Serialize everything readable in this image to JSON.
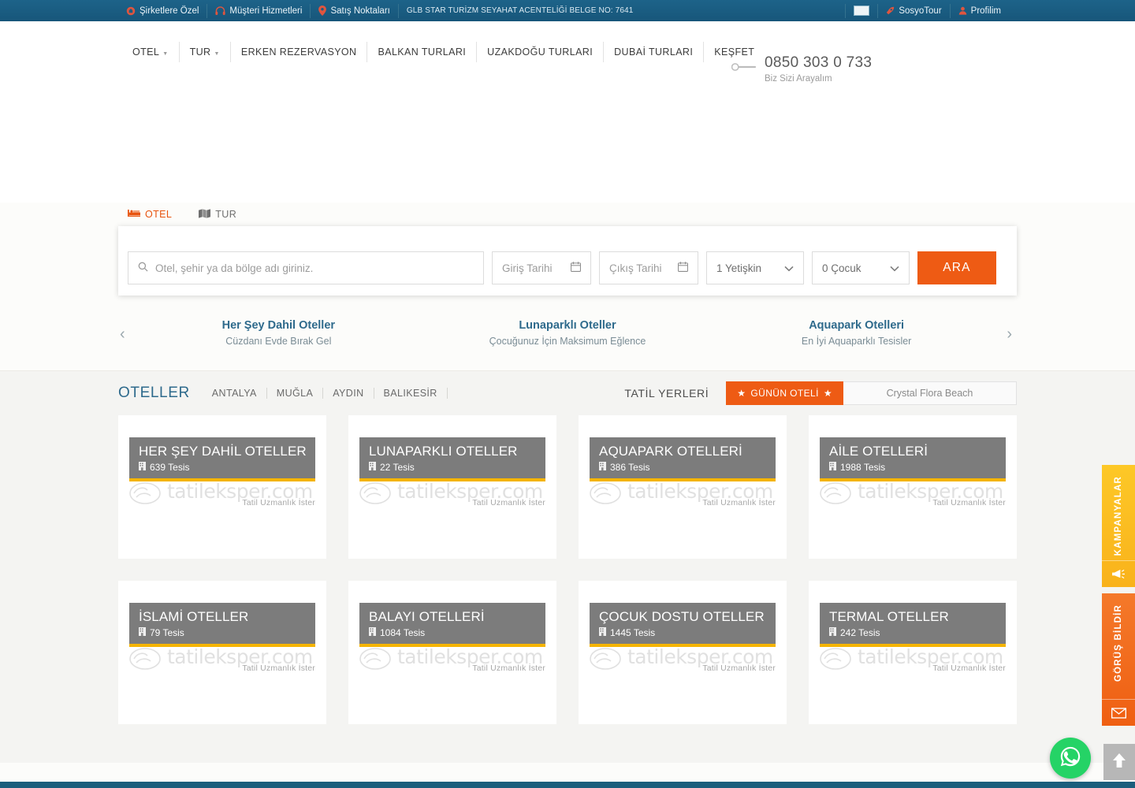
{
  "topbar": {
    "left_items": [
      {
        "icon": "briefcase-icon",
        "label": "Şirketlere Özel"
      },
      {
        "icon": "headset-icon",
        "label": "Müşteri Hizmetleri"
      },
      {
        "icon": "map-pin-icon",
        "label": "Satış Noktaları"
      }
    ],
    "license_text": "GLB STAR TURİZM SEYAHAT ACENTELİĞİ BELGE NO: 7641",
    "right_items": [
      {
        "icon": "flag-icon",
        "label": ""
      },
      {
        "icon": "rocket-icon",
        "label": "SosyoTour"
      },
      {
        "icon": "user-icon",
        "label": "Profilim"
      }
    ]
  },
  "nav": {
    "items": [
      {
        "label": "OTEL",
        "has_caret": true
      },
      {
        "label": "TUR",
        "has_caret": true
      },
      {
        "label": "ERKEN REZERVASYON",
        "has_caret": false
      },
      {
        "label": "BALKAN TURLARI",
        "has_caret": false
      },
      {
        "label": "UZAKDOĞU TURLARI",
        "has_caret": false
      },
      {
        "label": "DUBAİ TURLARI",
        "has_caret": false
      },
      {
        "label": "KEŞFET",
        "has_caret": false
      }
    ]
  },
  "phone": {
    "number": "0850 303 0 733",
    "subtitle": "Biz Sizi Arayalım"
  },
  "search": {
    "tabs": [
      {
        "label": "OTEL",
        "icon": "bed-icon",
        "active": true
      },
      {
        "label": "TUR",
        "icon": "map-book-icon",
        "active": false
      }
    ],
    "destination_placeholder": "Otel, şehir ya da bölge adı giriniz.",
    "checkin_placeholder": "Giriş Tarihi",
    "checkout_placeholder": "Çıkış Tarihi",
    "adults_value": "1 Yetişkin",
    "children_value": "0 Çocuk",
    "search_button": "ARA"
  },
  "promo": {
    "prev": "‹",
    "next": "›",
    "items": [
      {
        "title": "Her Şey Dahil Oteller",
        "subtitle": "Cüzdanı Evde Bırak Gel"
      },
      {
        "title": "Lunaparklı Oteller",
        "subtitle": "Çocuğunuz İçin Maksimum Eğlence"
      },
      {
        "title": "Aquapark Otelleri",
        "subtitle": "En İyi Aquaparklı Tesisler"
      }
    ]
  },
  "hotels": {
    "section_title": "OTELLER",
    "cities": [
      "ANTALYA",
      "MUĞLA",
      "AYDIN",
      "BALIKESİR"
    ],
    "tatil_label": "TATİL YERLERİ",
    "hotel_of_day_label": "GÜNÜN OTELİ",
    "hotel_of_day_name": "Crystal Flora Beach",
    "watermark_text": "tatileksper.com",
    "watermark_sub": "Tatil Uzmanlık İster",
    "cards": [
      {
        "title": "HER ŞEY DAHİL OTELLER",
        "count": "639 Tesis"
      },
      {
        "title": "LUNAPARKLI OTELLER",
        "count": "22 Tesis"
      },
      {
        "title": "AQUAPARK OTELLERİ",
        "count": "386 Tesis"
      },
      {
        "title": "AİLE OTELLERİ",
        "count": "1988 Tesis"
      },
      {
        "title": "İSLAMİ OTELLER",
        "count": "79 Tesis"
      },
      {
        "title": "BALAYI OTELLERİ",
        "count": "1084 Tesis"
      },
      {
        "title": "ÇOCUK DOSTU OTELLER",
        "count": "1445 Tesis"
      },
      {
        "title": "TERMAL OTELLER",
        "count": "242 Tesis"
      }
    ]
  },
  "side_tabs": [
    {
      "label": "KAMPANYALAR",
      "icon": "megaphone-icon",
      "color": "#fbbd20"
    },
    {
      "label": "GÖRÜŞ BİLDİR",
      "icon": "envelope-icon",
      "color": "#f06a1b"
    }
  ],
  "float_buttons": [
    {
      "name": "whatsapp-button",
      "icon": "whatsapp-icon",
      "color": "#25d366"
    },
    {
      "name": "scroll-top-button",
      "icon": "arrow-up-icon",
      "color": "#b7b7b7"
    }
  ],
  "colors": {
    "topbar_blue": "#1b5e83",
    "accent_orange": "#ee5b14",
    "heading_blue": "#2e6a8c",
    "card_gold": "#f5b400",
    "section_bg": "#f4f4f2"
  }
}
